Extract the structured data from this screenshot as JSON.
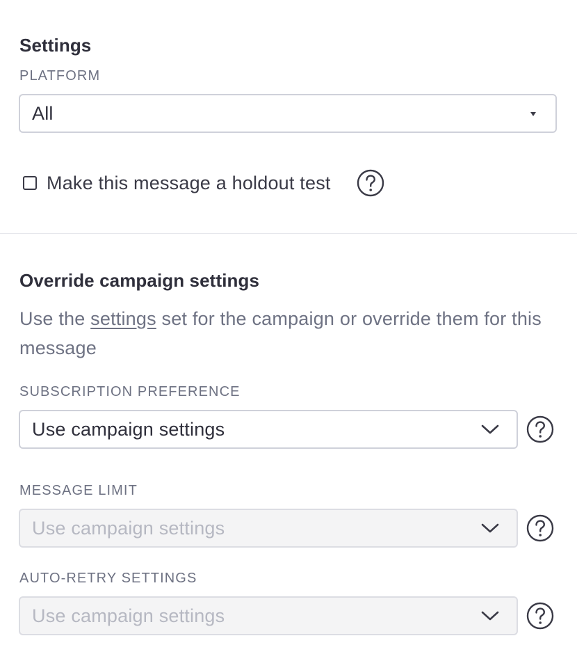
{
  "settings": {
    "title": "Settings",
    "platform_label": "PLATFORM",
    "platform_value": "All",
    "holdout_label": "Make this message a holdout test",
    "holdout_checked": false
  },
  "override": {
    "title": "Override campaign settings",
    "desc_before": "Use the ",
    "desc_link": "settings",
    "desc_after": " set for the campaign or override them for this message",
    "subscription_label": "SUBSCRIPTION PREFERENCE",
    "subscription_value": "Use campaign settings",
    "message_limit_label": "MESSAGE LIMIT",
    "message_limit_value": "Use campaign settings",
    "auto_retry_label": "AUTO-RETRY SETTINGS",
    "auto_retry_value": "Use campaign settings"
  },
  "icons": {
    "help": "help-circle-icon",
    "dropdown": "chevron-down-icon",
    "caret": "caret-down-icon"
  },
  "colors": {
    "text_dark": "#2f2f3b",
    "text_muted": "#6e7283",
    "border": "#cfd1da",
    "disabled_bg": "#f4f4f5",
    "disabled_text": "#b6b8c2"
  }
}
